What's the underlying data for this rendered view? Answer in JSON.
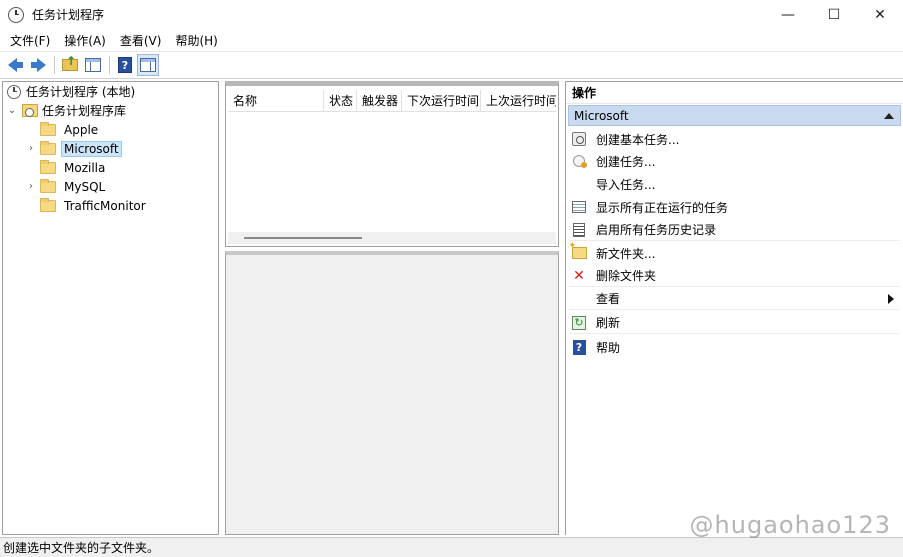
{
  "window": {
    "title": "任务计划程序",
    "controls": {
      "minimize": "—",
      "maximize": "☐",
      "close": "✕"
    }
  },
  "menu": [
    "文件(F)",
    "操作(A)",
    "查看(V)",
    "帮助(H)"
  ],
  "toolbar": {
    "buttons": [
      "back-icon",
      "forward-icon",
      "up-folder-icon",
      "show-hide-console-tree-icon",
      "help-icon",
      "show-hide-action-pane-icon"
    ]
  },
  "tree": {
    "root": "任务计划程序 (本地)",
    "library": "任务计划程序库",
    "folders": [
      {
        "label": "Apple",
        "expandable": false,
        "selected": false
      },
      {
        "label": "Microsoft",
        "expandable": true,
        "selected": true
      },
      {
        "label": "Mozilla",
        "expandable": false,
        "selected": false
      },
      {
        "label": "MySQL",
        "expandable": true,
        "selected": false
      },
      {
        "label": "TrafficMonitor",
        "expandable": false,
        "selected": false
      }
    ],
    "expander_collapsed": "›",
    "expander_expanded": "⌄"
  },
  "task_list": {
    "columns": [
      "名称",
      "状态",
      "触发器",
      "下次运行时间",
      "上次运行时间"
    ]
  },
  "actions": {
    "title": "操作",
    "section": "Microsoft",
    "items": [
      {
        "label": "创建基本任务...",
        "icon": "create-basic-task-icon"
      },
      {
        "label": "创建任务...",
        "icon": "create-task-icon"
      },
      {
        "label": "导入任务...",
        "icon": ""
      },
      {
        "label": "显示所有正在运行的任务",
        "icon": "running-tasks-icon"
      },
      {
        "label": "启用所有任务历史记录",
        "icon": "task-history-icon"
      },
      {
        "label": "新文件夹...",
        "icon": "new-folder-icon"
      },
      {
        "label": "删除文件夹",
        "icon": "delete-icon"
      },
      {
        "label": "查看",
        "icon": "",
        "submenu": true
      },
      {
        "label": "刷新",
        "icon": "refresh-icon"
      },
      {
        "label": "帮助",
        "icon": "help-icon"
      }
    ]
  },
  "status": "创建选中文件夹的子文件夹。",
  "watermark": "@hugaohao123"
}
